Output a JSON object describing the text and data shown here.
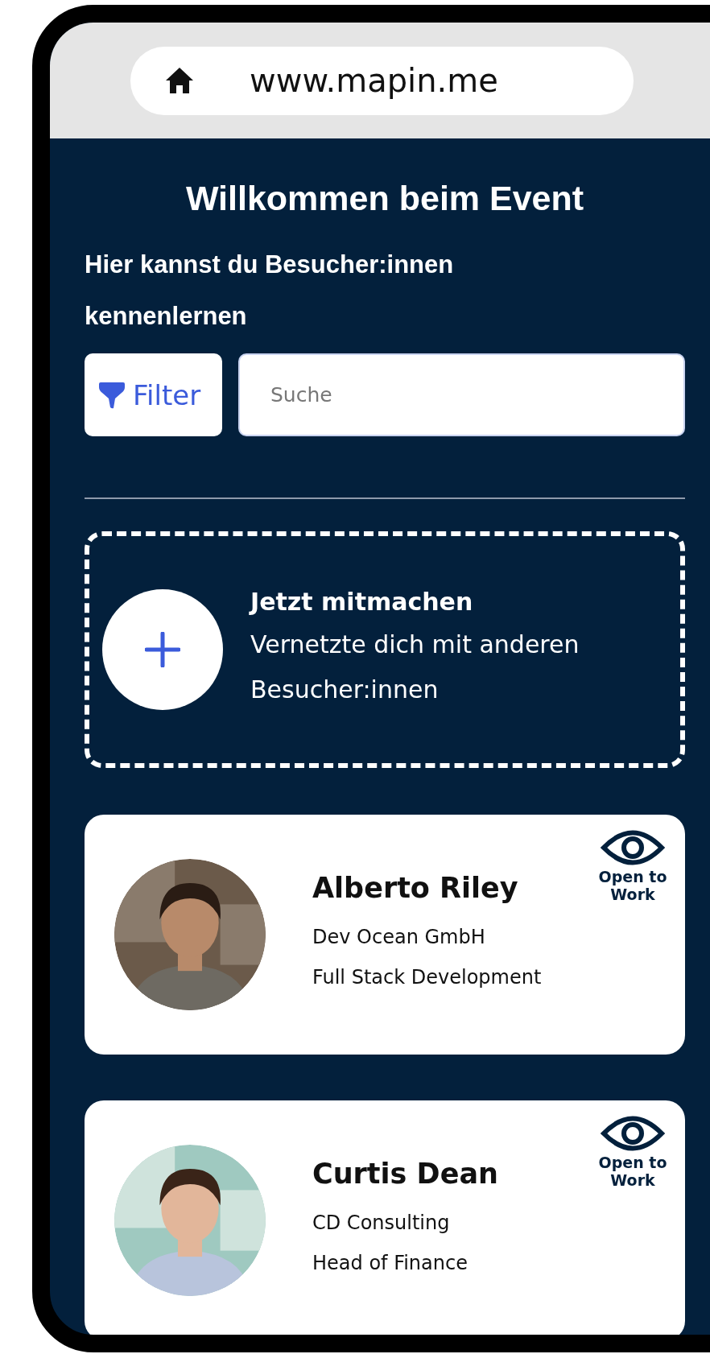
{
  "browser": {
    "url": "www.mapin.me"
  },
  "header": {
    "title": "Willkommen beim Event",
    "subtitle": "Hier kannst du Besucher:innen kennenlernen"
  },
  "filter": {
    "label": "Filter"
  },
  "search": {
    "placeholder": "Suche"
  },
  "join_card": {
    "title": "Jetzt mitmachen",
    "text": "Vernetzte dich mit anderen Besucher:innen"
  },
  "people": [
    {
      "name": "Alberto Riley",
      "company": "Dev Ocean GmbH",
      "role": "Full Stack Development",
      "badge": "Open to Work"
    },
    {
      "name": "Curtis Dean",
      "company": "CD Consulting",
      "role": "Head of Finance",
      "badge": "Open to Work"
    }
  ]
}
